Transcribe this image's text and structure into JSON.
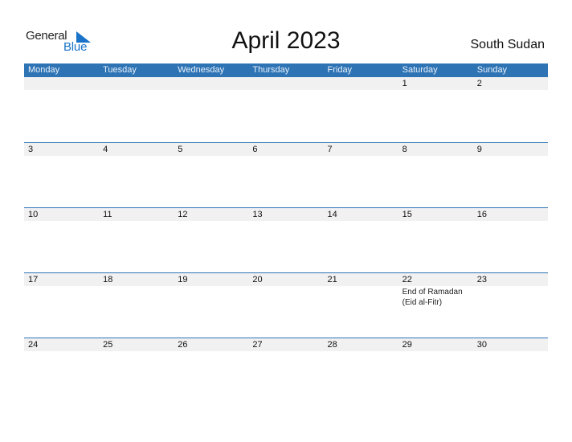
{
  "logo": {
    "word1": "General",
    "word2": "Blue"
  },
  "title": "April 2023",
  "country": "South Sudan",
  "weekdays": [
    "Monday",
    "Tuesday",
    "Wednesday",
    "Thursday",
    "Friday",
    "Saturday",
    "Sunday"
  ],
  "weeks": [
    {
      "days": [
        "",
        "",
        "",
        "",
        "",
        "1",
        "2"
      ]
    },
    {
      "days": [
        "3",
        "4",
        "5",
        "6",
        "7",
        "8",
        "9"
      ]
    },
    {
      "days": [
        "10",
        "11",
        "12",
        "13",
        "14",
        "15",
        "16"
      ]
    },
    {
      "days": [
        "17",
        "18",
        "19",
        "20",
        "21",
        "22",
        "23"
      ]
    },
    {
      "days": [
        "24",
        "25",
        "26",
        "27",
        "28",
        "29",
        "30"
      ]
    }
  ],
  "events": {
    "w3d5": "End of Ramadan (Eid al-Fitr)"
  },
  "colors": {
    "accent": "#2e74b5",
    "band": "#f1f1f1"
  }
}
